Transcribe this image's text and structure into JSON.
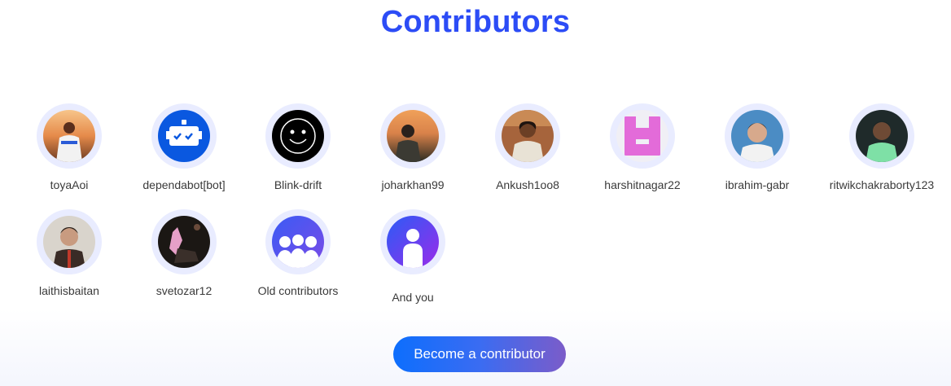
{
  "section": {
    "title": "Contributors"
  },
  "contributors": [
    {
      "name": "toyaAoi",
      "avatar_icon": "user-photo-icon"
    },
    {
      "name": "dependabot[bot]",
      "avatar_icon": "robot-icon"
    },
    {
      "name": "Blink-drift",
      "avatar_icon": "smiley-icon"
    },
    {
      "name": "joharkhan99",
      "avatar_icon": "user-photo-icon"
    },
    {
      "name": "Ankush1oo8",
      "avatar_icon": "user-photo-icon"
    },
    {
      "name": "harshitnagar22",
      "avatar_icon": "identicon-icon"
    },
    {
      "name": "ibrahim-gabr",
      "avatar_icon": "user-photo-icon"
    },
    {
      "name": "ritwikchakraborty123",
      "avatar_icon": "user-photo-icon"
    },
    {
      "name": "laithisbaitan",
      "avatar_icon": "user-photo-icon"
    },
    {
      "name": "svetozar12",
      "avatar_icon": "user-photo-icon"
    },
    {
      "name": "Old contributors",
      "avatar_icon": "group-icon"
    },
    {
      "name": "And you",
      "avatar_icon": "person-icon"
    }
  ],
  "cta": {
    "label": "Become a contributor"
  },
  "colors": {
    "title": "#2c4cf6",
    "ring": "#e9ecff",
    "button_start": "#0d6efd",
    "button_end": "#7b5cc9"
  }
}
